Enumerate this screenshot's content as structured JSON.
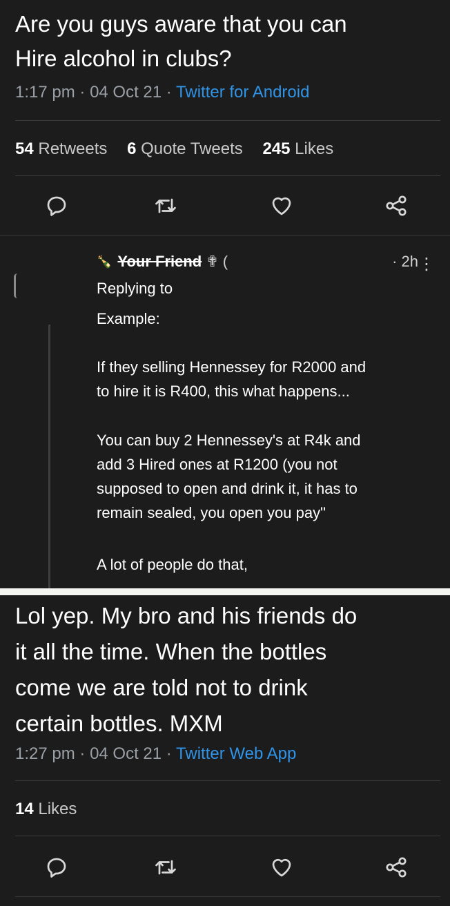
{
  "tweet_top": {
    "text": "Are you guys aware that you can\nHire alcohol in clubs?",
    "time": "1:17 pm",
    "date": "04 Oct 21",
    "source": "Twitter for Android",
    "stats": {
      "retweets_count": "54",
      "retweets_label": "Retweets",
      "quotes_count": "6",
      "quotes_label": "Quote Tweets",
      "likes_count": "245",
      "likes_label": "Likes"
    }
  },
  "reply": {
    "author": "Your Friend",
    "author_prefix_glyph": "🍾",
    "author_suffix_glyph": "✟ (",
    "time": "· 2h",
    "menu_glyph": "⋮",
    "replying_to": "Replying to",
    "paragraph_1": "Example:",
    "paragraph_2": "If they selling Hennessey for R2000 and\nto hire it is R400, this what happens...",
    "paragraph_3": "You can buy 2 Hennessey's at R4k and\nadd 3 Hired ones at R1200 (you not\nsupposed to open and drink it, it has to\nremain sealed, you open you pay\"",
    "paragraph_4": "A lot of people do that,"
  },
  "tweet_bottom": {
    "text": "Lol yep. My bro and his friends do\nit all the time. When the bottles\ncome we are told not to drink\ncertain bottles. MXM",
    "time": "1:27 pm",
    "date": "04 Oct 21",
    "source": "Twitter Web App",
    "likes_count": "14",
    "likes_label": "Likes"
  },
  "icons": [
    "reply-icon",
    "retweet-icon",
    "like-icon",
    "share-icon"
  ],
  "colors": {
    "background": "#1c1c1c",
    "link": "#2f93e8",
    "muted": "#9aa0a6"
  }
}
